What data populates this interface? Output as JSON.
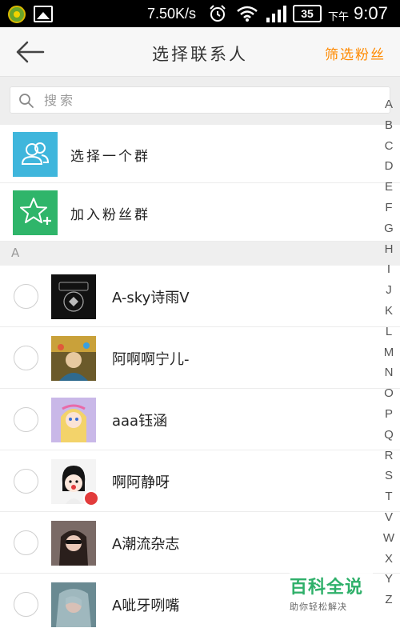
{
  "status_bar": {
    "speed": "7.50K/s",
    "battery": "35",
    "ampm": "下午",
    "time": "9:07"
  },
  "header": {
    "title": "选择联系人",
    "filter_label": "筛选粉丝"
  },
  "search": {
    "placeholder": "搜索"
  },
  "actions": [
    {
      "label": "选择一个群",
      "icon": "group-icon",
      "color": "#3fb6dc"
    },
    {
      "label": "加入粉丝群",
      "icon": "star-plus-icon",
      "color": "#2fb56a"
    }
  ],
  "section": {
    "letter": "A"
  },
  "contacts": [
    {
      "name": "A-sky诗雨V",
      "selected": false
    },
    {
      "name": "阿啊啊宁儿-",
      "selected": false
    },
    {
      "name": "aaa钰涵",
      "selected": false
    },
    {
      "name": "啊阿静呀",
      "selected": false
    },
    {
      "name": "A潮流杂志",
      "selected": false
    },
    {
      "name": "A呲牙咧嘴",
      "selected": false
    }
  ],
  "alpha_index": [
    "A",
    "B",
    "C",
    "D",
    "E",
    "F",
    "G",
    "H",
    "I",
    "J",
    "K",
    "L",
    "M",
    "N",
    "O",
    "P",
    "Q",
    "R",
    "S",
    "T",
    "V",
    "W",
    "X",
    "Y",
    "Z"
  ],
  "watermark": {
    "title": "百科全说",
    "subtitle": "助你轻松解决"
  },
  "colors": {
    "accent": "#ff8a00",
    "group_icon_bg": "#3fb6dc",
    "fans_icon_bg": "#2fb56a",
    "watermark": "#2fb06a"
  }
}
